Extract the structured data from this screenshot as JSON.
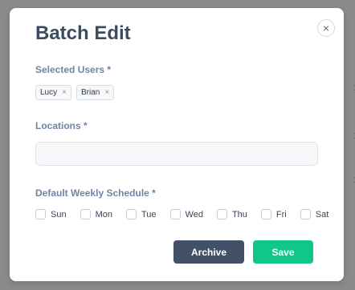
{
  "background": {
    "fragments": [
      ":",
      ":",
      ":"
    ]
  },
  "modal": {
    "title": "Batch Edit",
    "close_glyph": "×",
    "selected_users": {
      "label": "Selected Users *",
      "tags": [
        {
          "name": "Lucy",
          "remove": "×"
        },
        {
          "name": "Brian",
          "remove": "×"
        }
      ]
    },
    "locations": {
      "label": "Locations *",
      "value": "",
      "placeholder": ""
    },
    "schedule": {
      "label": "Default Weekly Schedule *",
      "days": [
        "Sun",
        "Mon",
        "Tue",
        "Wed",
        "Thu",
        "Fri",
        "Sat"
      ]
    },
    "buttons": {
      "archive": "Archive",
      "save": "Save"
    }
  },
  "colors": {
    "archive_bg": "#435168",
    "save_bg": "#10c68b",
    "title": "#3d4b60",
    "label": "#6f85a6"
  }
}
